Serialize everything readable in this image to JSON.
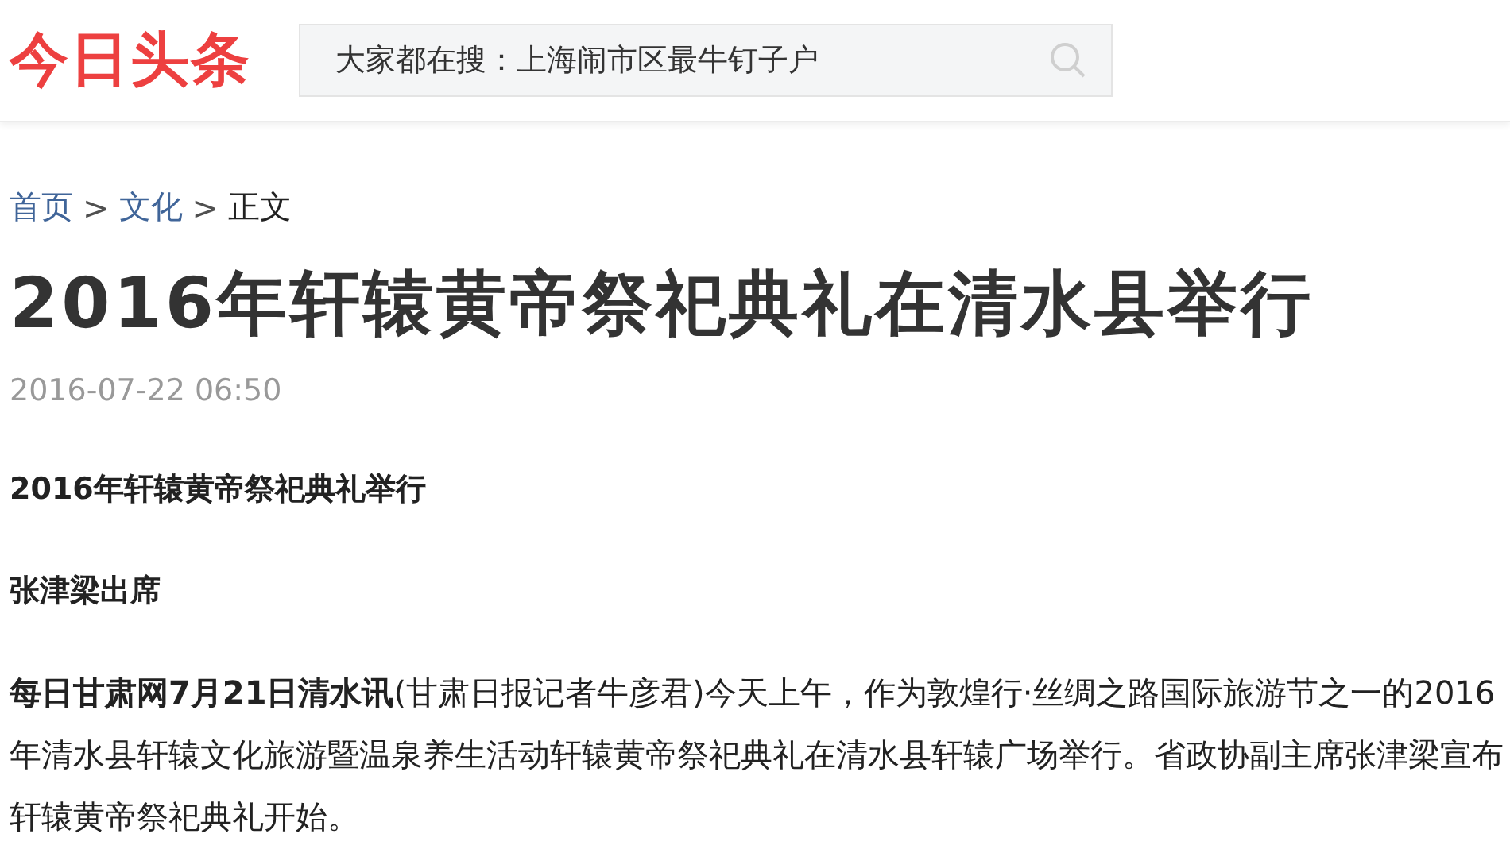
{
  "header": {
    "logo": "今日头条",
    "search": {
      "placeholder": "大家都在搜：上海闹市区最牛钉子户"
    }
  },
  "breadcrumb": [
    {
      "label": "首页",
      "kind": "link"
    },
    {
      "label": ">",
      "kind": "sep"
    },
    {
      "label": "文化",
      "kind": "link"
    },
    {
      "label": ">",
      "kind": "sep"
    },
    {
      "label": "正文",
      "kind": "current"
    }
  ],
  "article": {
    "title": "2016年轩辕黄帝祭祀典礼在清水县举行",
    "time": "2016-07-22 06:50",
    "subheadings": [
      "2016年轩辕黄帝祭祀典礼举行",
      "张津梁出席"
    ],
    "paragraph": "**每日甘肃网7月21日清水讯**(甘肃日报记者牛彦君)今天上午，作为敦煌行·丝绸之路国际旅游节之一的2016年清水县轩辕文化旅游暨温泉养生活动轩辕黄帝祭祀典礼在清水县轩辕广场举行。省政协副主席张津梁宣布轩辕黄帝祭祀典礼开始。"
  }
}
